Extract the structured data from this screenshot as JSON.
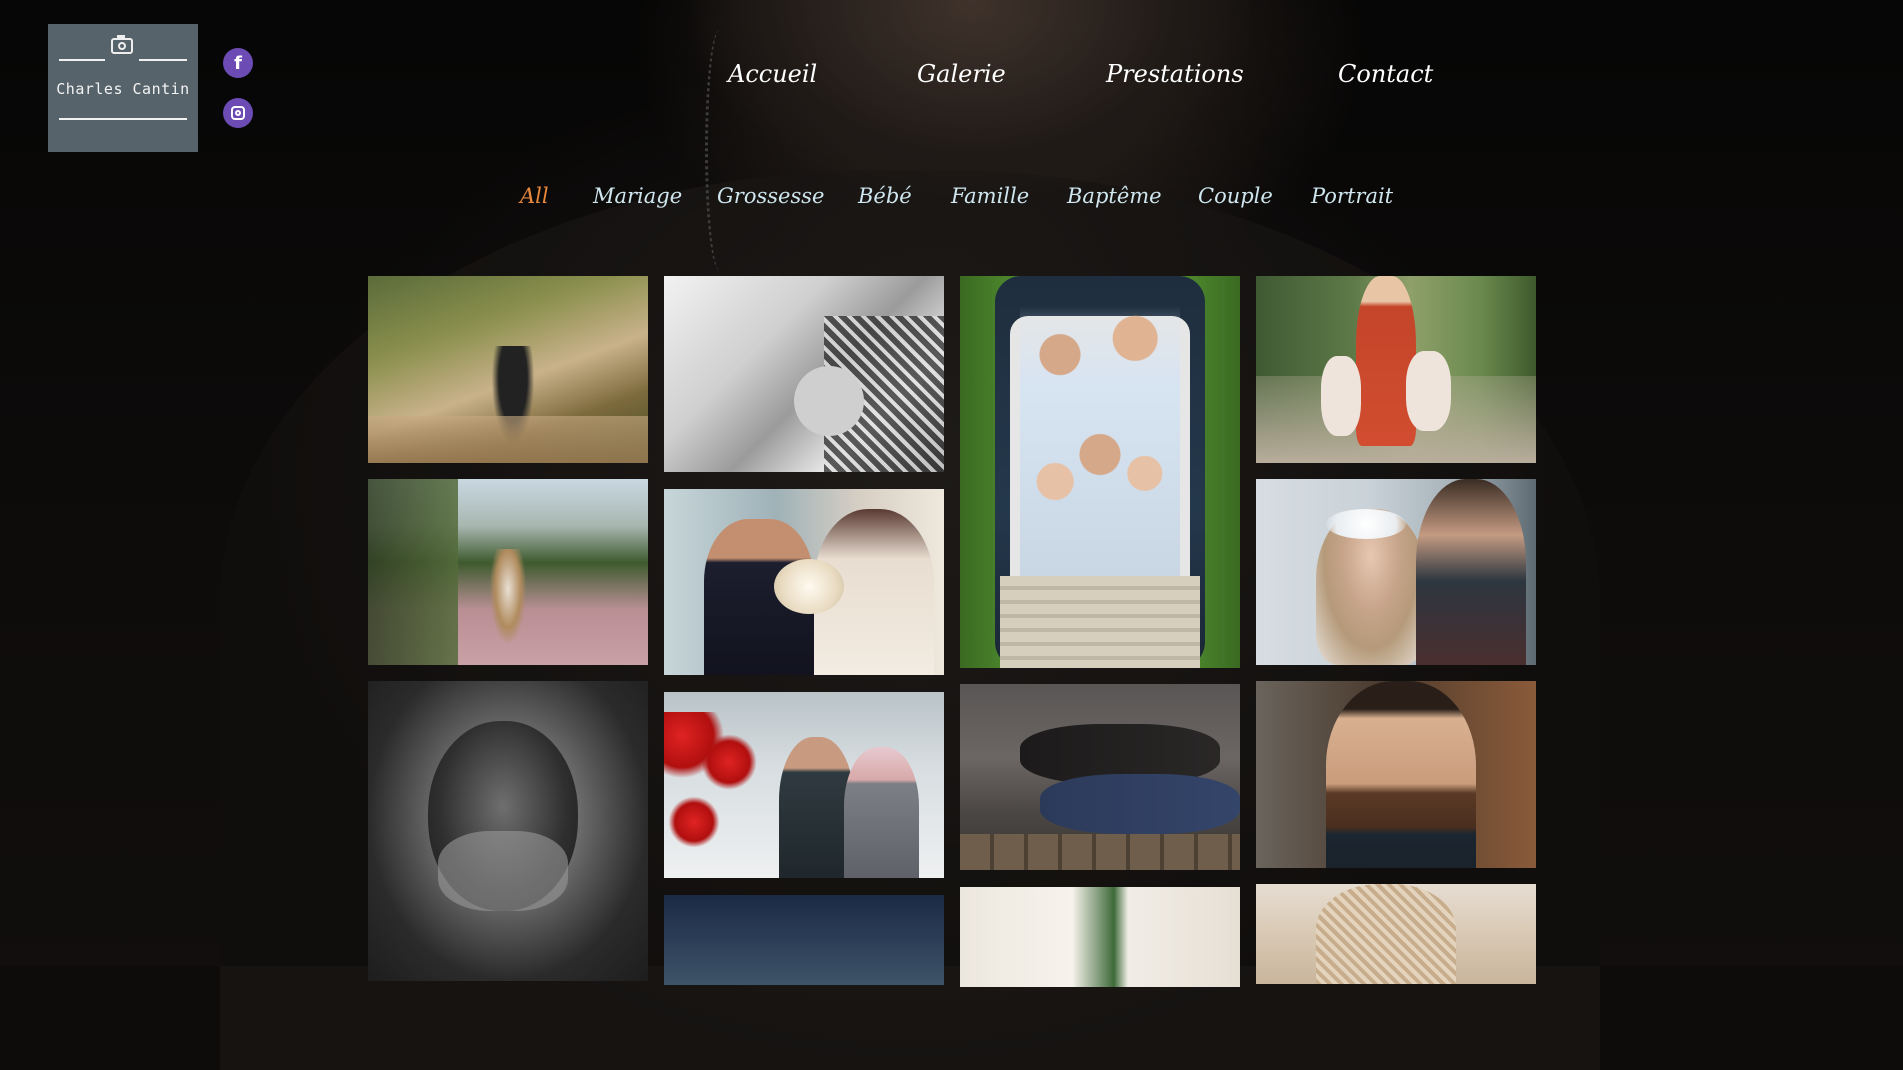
{
  "brand": {
    "name": "Charles Cantin"
  },
  "social": [
    {
      "icon": "facebook-icon",
      "glyph": "f"
    },
    {
      "icon": "instagram-icon"
    }
  ],
  "nav": [
    {
      "label": "Accueil"
    },
    {
      "label": "Galerie"
    },
    {
      "label": "Prestations"
    },
    {
      "label": "Contact"
    }
  ],
  "filters": [
    {
      "label": "All",
      "active": true
    },
    {
      "label": "Mariage"
    },
    {
      "label": "Grossesse"
    },
    {
      "label": "Bébé"
    },
    {
      "label": "Famille"
    },
    {
      "label": "Baptême"
    },
    {
      "label": "Couple"
    },
    {
      "label": "Portrait"
    }
  ],
  "colors": {
    "accent_active_filter": "#e9883a",
    "filter_text": "#cfe6ee",
    "logo_bg": "#56636b",
    "social_bg": "#6c4bb4"
  },
  "gallery": [
    {
      "subject": "couple-walking-forest-path"
    },
    {
      "subject": "baptism-water-pour"
    },
    {
      "subject": "family-in-convertible-car"
    },
    {
      "subject": "mother-and-daughters-road"
    },
    {
      "subject": "couple-pink-meadow-fence"
    },
    {
      "subject": "bride-groom-bouquet"
    },
    {
      "subject": "bride-flower-crown-kiss"
    },
    {
      "subject": "elderly-man-portrait"
    },
    {
      "subject": "couple-red-balloons"
    },
    {
      "subject": "couple-lying-on-wood"
    },
    {
      "subject": "bearded-man-portrait"
    },
    {
      "subject": "dark-forest"
    },
    {
      "subject": "baptism-infant-white"
    },
    {
      "subject": "newborn-baby-hat"
    }
  ]
}
